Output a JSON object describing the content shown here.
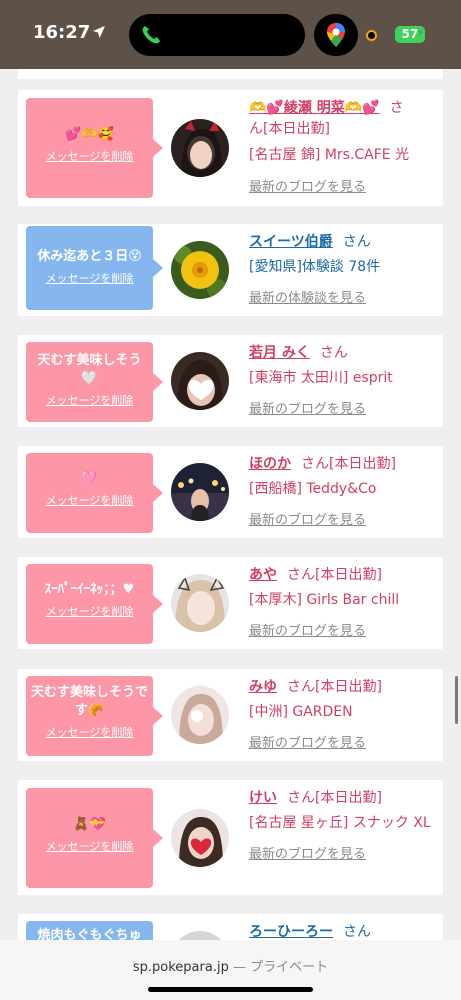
{
  "status": {
    "time": "16:27",
    "battery": "57"
  },
  "delete_label": "メッセージを削除",
  "san": "さん",
  "cards": [
    {
      "message": "💕🫶🥰",
      "name": "🫶💕綾瀬 明菜🫶💕",
      "line1_suffix": "さ",
      "line2": "ん[本日出勤]",
      "shop": "[名古屋 錦] Mrs.CAFE 光",
      "link": "最新のブログを見る"
    },
    {
      "message": "休み迄あと３日😵",
      "name": "スイーツ伯爵",
      "status": "",
      "shop": "[愛知県]体験談 78件",
      "link": "最新の体験談を見る"
    },
    {
      "message": "天むす美味しそう🤍",
      "name": "若月 みく",
      "status": "",
      "shop": "[東海市 太田川] esprit",
      "link": "最新のブログを見る"
    },
    {
      "message": "🩷",
      "name": "ほのか",
      "status": "[本日出勤]",
      "shop": "[西船橋] Teddy&Co",
      "link": "最新のブログを見る"
    },
    {
      "message": "ｽｰﾊﾟｰｲｰﾈｯ；；♥",
      "name": "あや",
      "status": "[本日出勤]",
      "shop": "[本厚木] Girls Bar chill",
      "link": "最新のブログを見る"
    },
    {
      "message": "天むす美味しそうです🥐",
      "name": "みゆ",
      "status": "[本日出勤]",
      "shop": "[中洲] GARDEN",
      "link": "最新のブログを見る"
    },
    {
      "message": "🧸💝",
      "name": "けい",
      "status": "[本日出勤]",
      "shop": "[名古屋 星ヶ丘] スナック XL",
      "link": "最新のブログを見る"
    },
    {
      "message": "焼肉もぐもぐちゅ",
      "name": "ろーひーろー",
      "status": "",
      "shop": "",
      "link": ""
    }
  ],
  "browser": {
    "url": "sp.pokepara.jp",
    "privacy": "— プライベート"
  }
}
